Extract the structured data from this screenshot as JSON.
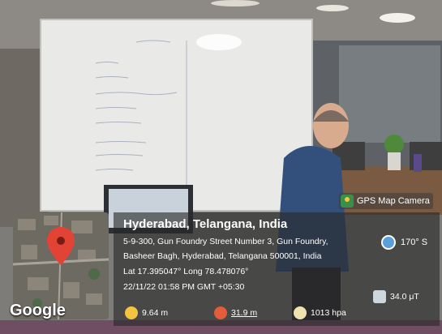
{
  "brand": {
    "label": "GPS Map Camera",
    "icon": "gps-map-camera-icon"
  },
  "map": {
    "attribution": "Google"
  },
  "location": {
    "title": "Hyderabad, Telangana, India",
    "address_line1": "5-9-300, Gun Foundry Street Number 3, Gun Foundry,",
    "address_line2": "Basheer Bagh, Hyderabad, Telangana 500001, India",
    "latlong": "Lat 17.395047° Long 78.478076°",
    "datetime": "22/11/22 01:58 PM GMT +05:30"
  },
  "sensors": {
    "compass": "170° S",
    "magnetic": "34.0 μT",
    "altitude": "9.64 m",
    "temperature": "31.9 m",
    "pressure": "1013 hpa"
  }
}
